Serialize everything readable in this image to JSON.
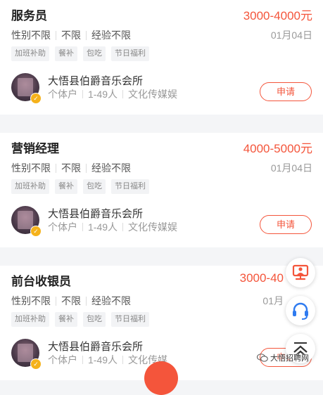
{
  "jobs": [
    {
      "title": "服务员",
      "salary": "3000-4000元",
      "requirements": [
        "性别不限",
        "不限",
        "经验不限"
      ],
      "date": "01月04日",
      "tags": [
        "加班补助",
        "餐补",
        "包吃",
        "节日福利"
      ],
      "company": "大悟县伯爵音乐会所",
      "company_type": "个体户",
      "company_size": "1-49人",
      "industry": "文化传媒娱",
      "apply_label": "申请"
    },
    {
      "title": "营销经理",
      "salary": "4000-5000元",
      "requirements": [
        "性别不限",
        "不限",
        "经验不限"
      ],
      "date": "01月04日",
      "tags": [
        "加班补助",
        "餐补",
        "包吃",
        "节日福利"
      ],
      "company": "大悟县伯爵音乐会所",
      "company_type": "个体户",
      "company_size": "1-49人",
      "industry": "文化传媒娱",
      "apply_label": "申请"
    },
    {
      "title": "前台收银员",
      "salary": "3000-40",
      "requirements": [
        "性别不限",
        "不限",
        "经验不限"
      ],
      "date": "01月",
      "tags": [
        "加班补助",
        "餐补",
        "包吃",
        "节日福利"
      ],
      "company": "大悟县伯爵音乐会所",
      "company_type": "个体户",
      "company_size": "1-49人",
      "industry": "文化传媒",
      "apply_label": "申请"
    }
  ],
  "floating": {
    "hr_icon": "presentation-icon",
    "service_icon": "headset-icon",
    "top_icon": "chevron-up-icon"
  },
  "watermark": "大悟招聘网",
  "colors": {
    "accent": "#f4553b",
    "verify": "#f5b21b",
    "service": "#2f7bf0"
  }
}
